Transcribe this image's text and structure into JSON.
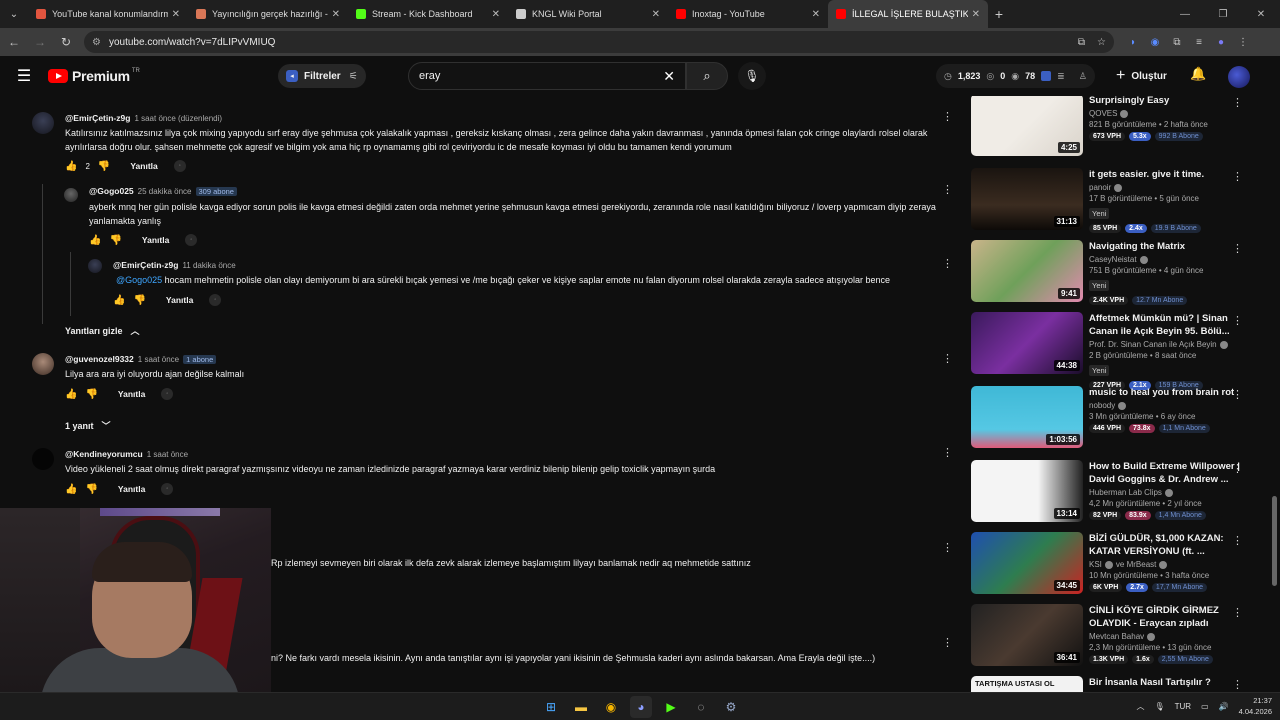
{
  "browser": {
    "tabs": [
      {
        "label": "YouTube kanal konumlandırma",
        "color": "#e2553f",
        "active": false
      },
      {
        "label": "Yayıncılığın gerçek hazırlığı - Cl",
        "color": "#d97757",
        "active": false
      },
      {
        "label": "Stream - Kick Dashboard",
        "color": "#53fc18",
        "active": false
      },
      {
        "label": "KNGL Wiki Portal",
        "color": "#cccccc",
        "active": false
      },
      {
        "label": "Inoxtag - YouTube",
        "color": "#ff0000",
        "active": false
      },
      {
        "label": "İLLEGAL İŞLERE BULAŞTIK! POL",
        "color": "#ff0000",
        "active": true
      }
    ],
    "url": "youtube.com/watch?v=7dLIPvVMIUQ"
  },
  "header": {
    "brand": "Premium",
    "country": "TR",
    "filters_label": "Filtreler",
    "search_value": "eray",
    "stats": {
      "views": "1,823",
      "a": "0",
      "b": "78"
    },
    "create_label": "Oluştur"
  },
  "comments": [
    {
      "author": "@EmirÇetin-z9g",
      "time": "1 saat önce (düzenlendi)",
      "text": "Katılırsınız katılmazsınız lilya çok mixing yapıyodu sırf eray diye şehmusa çok yalakalık yapması , gereksiz kıskanç olması , zera gelince daha yakın davranması , yanında öpmesi falan çok cringe olaylardı rolsel olarak ayrılırlarsa doğru olur. şahsen mehmette çok agresif ve bilgim yok ama hiç rp oynamamış gibi rol çeviriyordu ic de mesafe koyması iyi oldu bu tamamen kendi yorumum",
      "likes": "2",
      "reply": "Yanıtla"
    },
    {
      "author": "@Gogo025",
      "time": "25 dakika önce",
      "subs": "309 abone",
      "text": "ayberk mnq her gün polisle kavga ediyor sorun polis ile kavga etmesi değildi zaten orda mehmet yerine şehmusun kavga etmesi gerekiyordu, zeranında role nasıl katıldığını biliyoruz / loverp yapmıcam diyip zeraya yanlamakta yanlış",
      "reply": "Yanıtla"
    },
    {
      "author": "@EmirÇetin-z9g",
      "time": "11 dakika önce",
      "mention": "@Gogo025",
      "text": " hocam mehmetin polisle olan olayı demiyorum bi ara sürekli bıçak yemesi ve /me bıçağı çeker ve kişiye saplar emote nu falan diyorum rolsel olarakda zerayla sadece atışıyolar bence",
      "reply": "Yanıtla"
    },
    {
      "hide_replies": "Yanıtları gizle"
    },
    {
      "author": "@guvenozel9332",
      "time": "1 saat önce",
      "subs": "1 abone",
      "text": "Lilya ara ara iyi oluyordu ajan değilse kalmalı",
      "reply": "Yanıtla",
      "replies_toggle": "1 yanıt"
    },
    {
      "author": "@Kendineyorumcu",
      "time": "1 saat önce",
      "text": "Video yükleneli 2 saat olmuş direkt paragraf yazmışsınız videoyu ne zaman izledinizde paragraf yazmaya karar verdiniz bilenip bilenip gelip toxiclik yapmayın şurda",
      "reply": "Yanıtla"
    },
    {
      "text": "Rp izlemeyi sevmeyen biri olarak ilk defa zevk alarak izlemeye başlamıştım lilyayı banlamak nedir aq mehmetide sattınız"
    },
    {
      "text": "ni? Ne farkı vardı mesela ikisinin. Aynı anda tanıştılar aynı işi yapıyolar yani ikisinin de Şehmusla kaderi aynı aslında bakarsan. Ama Erayla değil işte....)"
    }
  ],
  "sidebar": [
    {
      "title": "Surprisingly Easy",
      "channel": "QOVES",
      "meta": "821 B görüntüleme • 2 hafta önce",
      "vph": "673 VPH",
      "ratio": "5.3x",
      "ratio_color": "#3b5fc2",
      "subs": "992 B Abone",
      "duration": "4:25",
      "thumb_bg": "linear-gradient(135deg,#f0ece6 0%,#f0ece6 50%,#d9d3ca 100%)"
    },
    {
      "title": "it gets easier. give it time.",
      "channel": "panoir",
      "meta": "17 B görüntüleme • 5 gün önce",
      "new": "Yeni",
      "vph": "85 VPH",
      "ratio": "2.4x",
      "ratio_color": "#3b5fc2",
      "subs": "19.9 B Abone",
      "duration": "31:13",
      "thumb_bg": "linear-gradient(180deg,#1a1410 0%,#3b2c20 60%,#0d0a08 100%)"
    },
    {
      "title": "Navigating the Matrix",
      "channel": "CaseyNeistat",
      "meta": "751 B görüntüleme • 4 gün önce",
      "new": "Yeni",
      "vph": "2.4K VPH",
      "ratio": "",
      "ratio_color": "",
      "subs": "12.7 Mn Abone",
      "duration": "9:41",
      "thumb_bg": "linear-gradient(135deg,#c9b48a 0%,#6fa05a 50%,#e28ab0 100%)"
    },
    {
      "title": "Affetmek Mümkün mü? | Sinan Canan ile Açık Beyin 95. Bölü...",
      "channel": "Prof. Dr. Sinan Canan ile Açık Beyin",
      "meta": "2 B görüntüleme • 8 saat önce",
      "new": "Yeni",
      "vph": "227 VPH",
      "ratio": "2.1x",
      "ratio_color": "#3b5fc2",
      "subs": "159 B Abone",
      "duration": "44:38",
      "thumb_bg": "linear-gradient(135deg,#3a1a5c 0%,#7a2fa0 50%,#1a0d2a 100%)"
    },
    {
      "title": "music to heal you from brain rot",
      "channel": "nobody",
      "meta": "3 Mn görüntüleme • 6 ay önce",
      "vph": "446 VPH",
      "ratio": "73.8x",
      "ratio_color": "#8a2a4a",
      "subs": "1,1 Mn Abone",
      "duration": "1:03:56",
      "thumb_bg": "linear-gradient(180deg,#3fb8d6 0%,#55c8e4 70%,#e05a7a 100%)"
    },
    {
      "title": "How to Build Extreme Willpower | David Goggins & Dr. Andrew ...",
      "channel": "Huberman Lab Clips",
      "meta": "4,2 Mn görüntüleme • 2 yıl önce",
      "vph": "82 VPH",
      "ratio": "83.9x",
      "ratio_color": "#8a2a4a",
      "subs": "1,4 Mn Abone",
      "duration": "13:14",
      "thumb_bg": "linear-gradient(90deg,#f4f4f4 0%,#f4f4f4 60%,#222 100%)"
    },
    {
      "title": "BİZİ GÜLDÜR, $1,000 KAZAN: KATAR VERSİYONU (ft. ...",
      "channel": "KSI",
      "channel2": "ve MrBeast",
      "meta": "10 Mn görüntüleme • 3 hafta önce",
      "vph": "6K VPH",
      "ratio": "2.7x",
      "ratio_color": "#3b5fc2",
      "subs": "17,7 Mn Abone",
      "duration": "34:45",
      "thumb_bg": "linear-gradient(135deg,#1f4fb0 0%,#2e7d4f 50%,#c22 100%)"
    },
    {
      "title": "CİNLİ KÖYE GİRDİK GİRMEZ OLAYDIK - Eraycan zıpladı",
      "channel": "Mevtcan Bahav",
      "meta": "2,3 Mn görüntüleme • 13 gün önce",
      "vph": "1.3K VPH",
      "ratio": "1.6x",
      "ratio_color": "#1f1f1f",
      "subs": "2,55 Mn Abone",
      "duration": "36:41",
      "thumb_bg": "linear-gradient(135deg,#222 0%,#4a3a30 50%,#111 100%)"
    },
    {
      "title": "Bir İnsanla Nasıl Tartışılır ?",
      "channel": "",
      "meta": "",
      "vph": "",
      "ratio": "",
      "ratio_color": "",
      "subs": "",
      "duration": "",
      "thumb_bg": "linear-gradient(180deg,#f2f2f2 0%,#f2f2f2 30%,#111 100%)",
      "thumb_text": "TARTIŞMA USTASI OL"
    }
  ],
  "taskbar": {
    "lang": "TUR",
    "time": "21:37",
    "date": "4.04.2026"
  }
}
